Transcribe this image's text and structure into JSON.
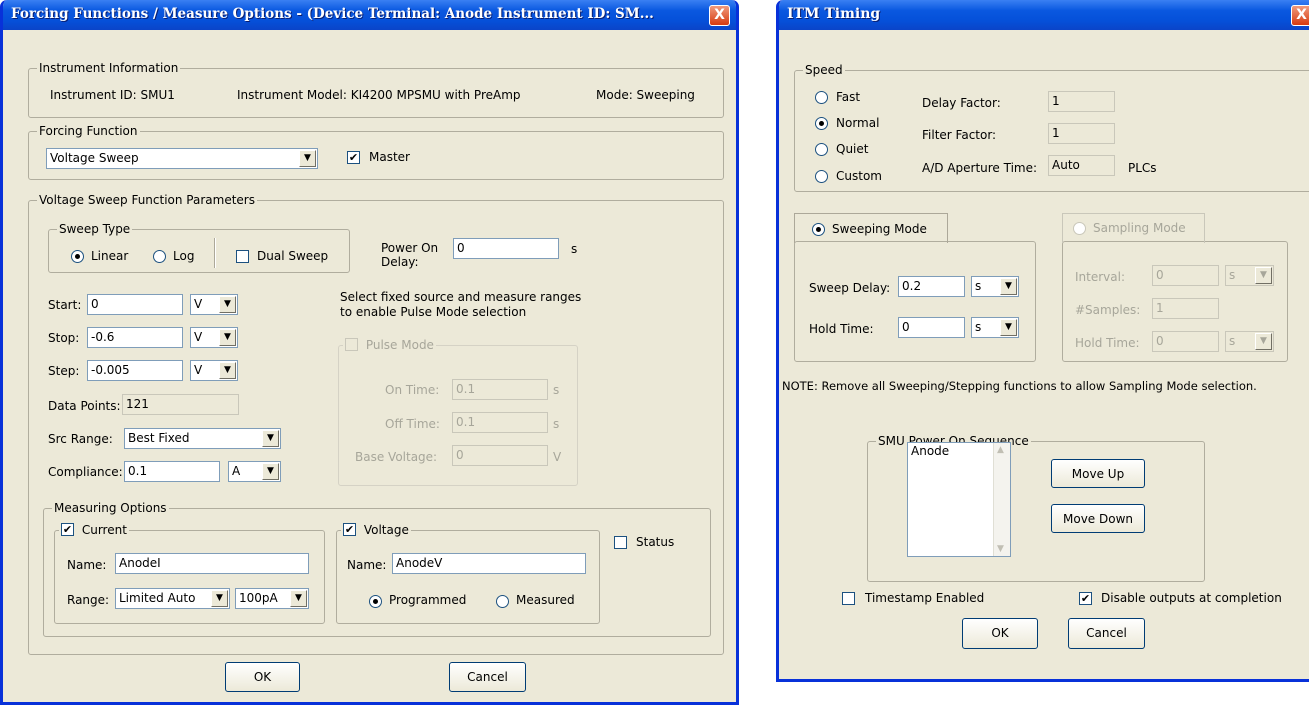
{
  "left": {
    "title": "Forcing Functions / Measure Options - (Device Terminal: Anode  Instrument ID: SM...",
    "close": "X",
    "info": {
      "group": "Instrument Information",
      "id": "Instrument ID:  SMU1",
      "model": "Instrument Model:  KI4200 MPSMU with PreAmp",
      "mode": "Mode:  Sweeping"
    },
    "forcing": {
      "group": "Forcing Function",
      "value": "Voltage Sweep",
      "master_label": "Master",
      "master_checked": "✔"
    },
    "params": {
      "group": "Voltage Sweep Function Parameters",
      "sweep_type": {
        "group": "Sweep Type",
        "linear": "Linear",
        "log": "Log",
        "dual": "Dual Sweep"
      },
      "power_on_label": "Power On",
      "power_on_label2": "Delay:",
      "power_on_value": "0",
      "power_on_unit": "s",
      "start": {
        "label": "Start:",
        "value": "0",
        "unit": "V"
      },
      "stop": {
        "label": "Stop:",
        "value": "-0.6",
        "unit": "V"
      },
      "step": {
        "label": "Step:",
        "value": "-0.005",
        "unit": "V"
      },
      "points": {
        "label": "Data Points:",
        "value": "121"
      },
      "src_range": {
        "label": "Src Range:",
        "value": "Best Fixed"
      },
      "compliance": {
        "label": "Compliance:",
        "value": "0.1",
        "unit": "A"
      },
      "note1": "Select fixed source and measure ranges",
      "note2": "to enable Pulse Mode selection",
      "pulse": {
        "label": "Pulse Mode",
        "on_label": "On Time:",
        "on_value": "0.1",
        "on_unit": "s",
        "off_label": "Off Time:",
        "off_value": "0.1",
        "off_unit": "s",
        "base_label": "Base Voltage:",
        "base_value": "0",
        "base_unit": "V"
      }
    },
    "measure": {
      "group": "Measuring Options",
      "current": {
        "label": "Current",
        "checked": "✔",
        "name_label": "Name:",
        "name_value": "AnodeI",
        "range_label": "Range:",
        "range_value": "Limited Auto",
        "range_value2": "100pA"
      },
      "voltage": {
        "label": "Voltage",
        "checked": "✔",
        "name_label": "Name:",
        "name_value": "AnodeV",
        "programmed": "Programmed",
        "measured": "Measured"
      },
      "status": "Status"
    },
    "ok": "OK",
    "cancel": "Cancel"
  },
  "right": {
    "title": "ITM Timing",
    "speed": {
      "group": "Speed",
      "fast": "Fast",
      "normal": "Normal",
      "quiet": "Quiet",
      "custom": "Custom",
      "delay_label": "Delay Factor:",
      "delay_value": "1",
      "filter_label": "Filter Factor:",
      "filter_value": "1",
      "ad_label": "A/D Aperture Time:",
      "ad_value": "Auto",
      "ad_unit": "PLCs"
    },
    "sweeping": {
      "tab": "Sweeping Mode",
      "delay_label": "Sweep Delay:",
      "delay_value": "0.2",
      "delay_unit": "s",
      "hold_label": "Hold Time:",
      "hold_value": "0",
      "hold_unit": "s"
    },
    "sampling": {
      "tab": "Sampling Mode",
      "interval_label": "Interval:",
      "interval_value": "0",
      "interval_unit": "s",
      "samples_label": "#Samples:",
      "samples_value": "1",
      "hold_label": "Hold Time:",
      "hold_value": "0",
      "hold_unit": "s"
    },
    "note": "NOTE: Remove all Sweeping/Stepping functions to allow Sampling Mode selection.",
    "seq": {
      "group": "SMU Power On Sequence",
      "items": [
        "Anode"
      ],
      "up": "Move Up",
      "down": "Move Down"
    },
    "timestamp": "Timestamp Enabled",
    "disable": "Disable outputs at completion",
    "disable_checked": "✔",
    "ok": "OK",
    "cancel": "Cancel"
  }
}
